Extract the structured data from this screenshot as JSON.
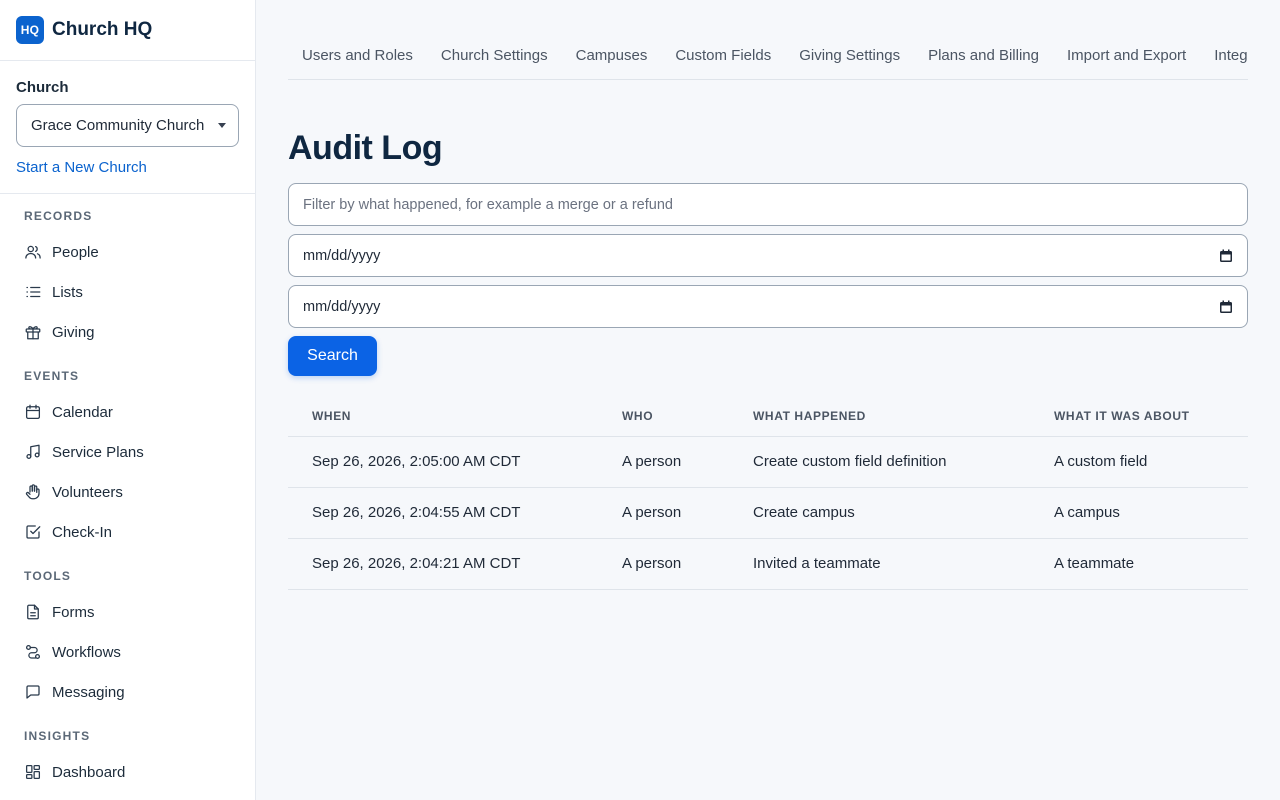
{
  "brand": {
    "logo_text": "HQ",
    "name": "Church HQ",
    "accent": "#0b63ce"
  },
  "church": {
    "label": "Church",
    "selected": "Grace Community Church",
    "new_link": "Start a New Church"
  },
  "nav": {
    "records": {
      "title": "RECORDS",
      "items": [
        {
          "label": "People",
          "icon": "people-icon"
        },
        {
          "label": "Lists",
          "icon": "list-icon"
        },
        {
          "label": "Giving",
          "icon": "gift-icon"
        }
      ]
    },
    "events": {
      "title": "EVENTS",
      "items": [
        {
          "label": "Calendar",
          "icon": "calendar-icon"
        },
        {
          "label": "Service Plans",
          "icon": "music-note-icon"
        },
        {
          "label": "Volunteers",
          "icon": "hand-icon"
        },
        {
          "label": "Check-In",
          "icon": "checkbox-icon"
        }
      ]
    },
    "tools": {
      "title": "TOOLS",
      "items": [
        {
          "label": "Forms",
          "icon": "document-icon"
        },
        {
          "label": "Workflows",
          "icon": "workflow-icon"
        },
        {
          "label": "Messaging",
          "icon": "message-icon"
        }
      ]
    },
    "insights": {
      "title": "INSIGHTS",
      "items": [
        {
          "label": "Dashboard",
          "icon": "dashboard-icon"
        }
      ]
    }
  },
  "tabs": [
    {
      "label": "Users and Roles"
    },
    {
      "label": "Church Settings"
    },
    {
      "label": "Campuses"
    },
    {
      "label": "Custom Fields"
    },
    {
      "label": "Giving Settings"
    },
    {
      "label": "Plans and Billing"
    },
    {
      "label": "Import and Export"
    },
    {
      "label": "Integrations"
    }
  ],
  "page": {
    "title": "Audit Log",
    "filter_placeholder": "Filter by what happened, for example a merge or a refund",
    "start_date": "mm/dd/yyyy",
    "end_date": "mm/dd/yyyy",
    "search_label": "Search",
    "primary_color": "#0b63e5"
  },
  "table": {
    "columns": {
      "when": "WHEN",
      "who": "WHO",
      "what": "WHAT HAPPENED",
      "about": "WHAT IT WAS ABOUT"
    },
    "rows": [
      {
        "when": "Sep 26, 2026, 2:05:00 AM CDT",
        "who": "A person",
        "what": "Create custom field definition",
        "about": "A custom field"
      },
      {
        "when": "Sep 26, 2026, 2:04:55 AM CDT",
        "who": "A person",
        "what": "Create campus",
        "about": "A campus"
      },
      {
        "when": "Sep 26, 2026, 2:04:21 AM CDT",
        "who": "A person",
        "what": "Invited a teammate",
        "about": "A teammate"
      }
    ]
  }
}
